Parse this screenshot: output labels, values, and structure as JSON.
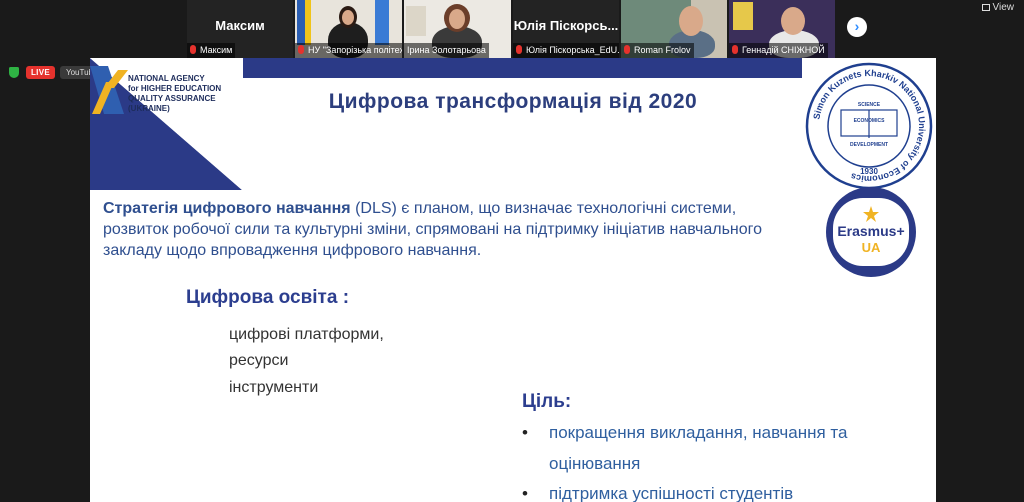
{
  "gallery": {
    "tiles": [
      {
        "name": "Максим",
        "caption": "Максим",
        "mic": "muted-mic-icon"
      },
      {
        "name": "",
        "caption": "НУ \"Запорізька політехні...",
        "mic": "muted-mic-icon"
      },
      {
        "name": "",
        "caption": "Ірина Золотарьова",
        "mic": ""
      },
      {
        "name": "Юлія Піскорсь...",
        "caption": "Юлія Піскорська_EdU...",
        "mic": "muted-mic-icon"
      },
      {
        "name": "",
        "caption": "Roman Frolov",
        "mic": "muted-mic-icon"
      },
      {
        "name": "",
        "caption": "Геннадій СНІЖНОЙ",
        "mic": "muted-mic-icon"
      }
    ],
    "next_label": "›",
    "view_label": "View"
  },
  "stream": {
    "live_label": "LIVE",
    "platform_label": "YouTube"
  },
  "slide": {
    "agency_lines": [
      "NATIONAL AGENCY",
      "for HIGHER EDUCATION",
      "QUALITY ASSURANCE",
      "(UKRAINE)"
    ],
    "title": "Цифрова трансформація від 2020",
    "paragraph_bold": "Стратегія цифрового навчання",
    "paragraph_rest": " (DLS) є планом, що визначає технологічні системи, розвиток робочої сили та культурні зміни, спрямовані на підтримку ініціатив навчального закладу щодо впровадження цифрового навчання.",
    "section_heading": "Цифрова освіта :",
    "items": [
      "цифрові платформи,",
      "ресурси",
      "інструменти"
    ],
    "goal_heading": "Ціль:",
    "goal_bullets": [
      {
        "line1": "покращення викладання, навчання та",
        "line2": "оцінювання"
      },
      {
        "line1": "підтримка успішності студентів",
        "line2": ""
      }
    ],
    "bullet_char": "•",
    "seal": {
      "ring_text": "Simon Kuznets Kharkiv National University of Economics",
      "year": "1930",
      "book_words": [
        "SCIENCE",
        "ECONOMICS",
        "DEVELOPMENT"
      ]
    },
    "erasmus": {
      "line1": "Erasmus+",
      "line2": "UA"
    }
  },
  "colors": {
    "accent_blue": "#2b3a87",
    "live_red": "#e5322d",
    "title_blue": "#2c3e7d"
  }
}
